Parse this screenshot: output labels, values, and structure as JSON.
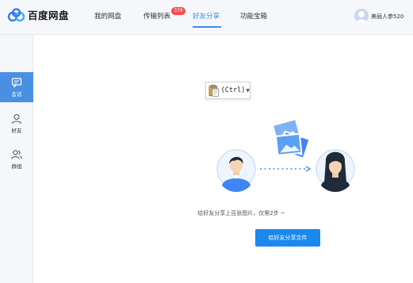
{
  "app": {
    "logo_text": "百度网盘"
  },
  "nav": {
    "items": [
      {
        "label": "我的网盘",
        "active": false
      },
      {
        "label": "传输列表",
        "active": false,
        "badge": "379"
      },
      {
        "label": "好友分享",
        "active": true
      },
      {
        "label": "功能宝箱",
        "active": false
      }
    ]
  },
  "user": {
    "name": "美丽人参520"
  },
  "sidebar": {
    "items": [
      {
        "label": "会话",
        "icon": "chat-icon",
        "active": true
      },
      {
        "label": "好友",
        "icon": "person-icon",
        "active": false
      },
      {
        "label": "群组",
        "icon": "group-icon",
        "active": false
      }
    ]
  },
  "paste_popup": {
    "label": "(Ctrl)",
    "icon": "clipboard-icon"
  },
  "main": {
    "hint": "给好友分享上百张图片，仅需2步 ~",
    "share_button": "给好友分享文件"
  },
  "colors": {
    "accent": "#3b8cf0",
    "button": "#1b88ee",
    "badge": "#f54c4c",
    "sidebar_active": "#4a90e2"
  }
}
